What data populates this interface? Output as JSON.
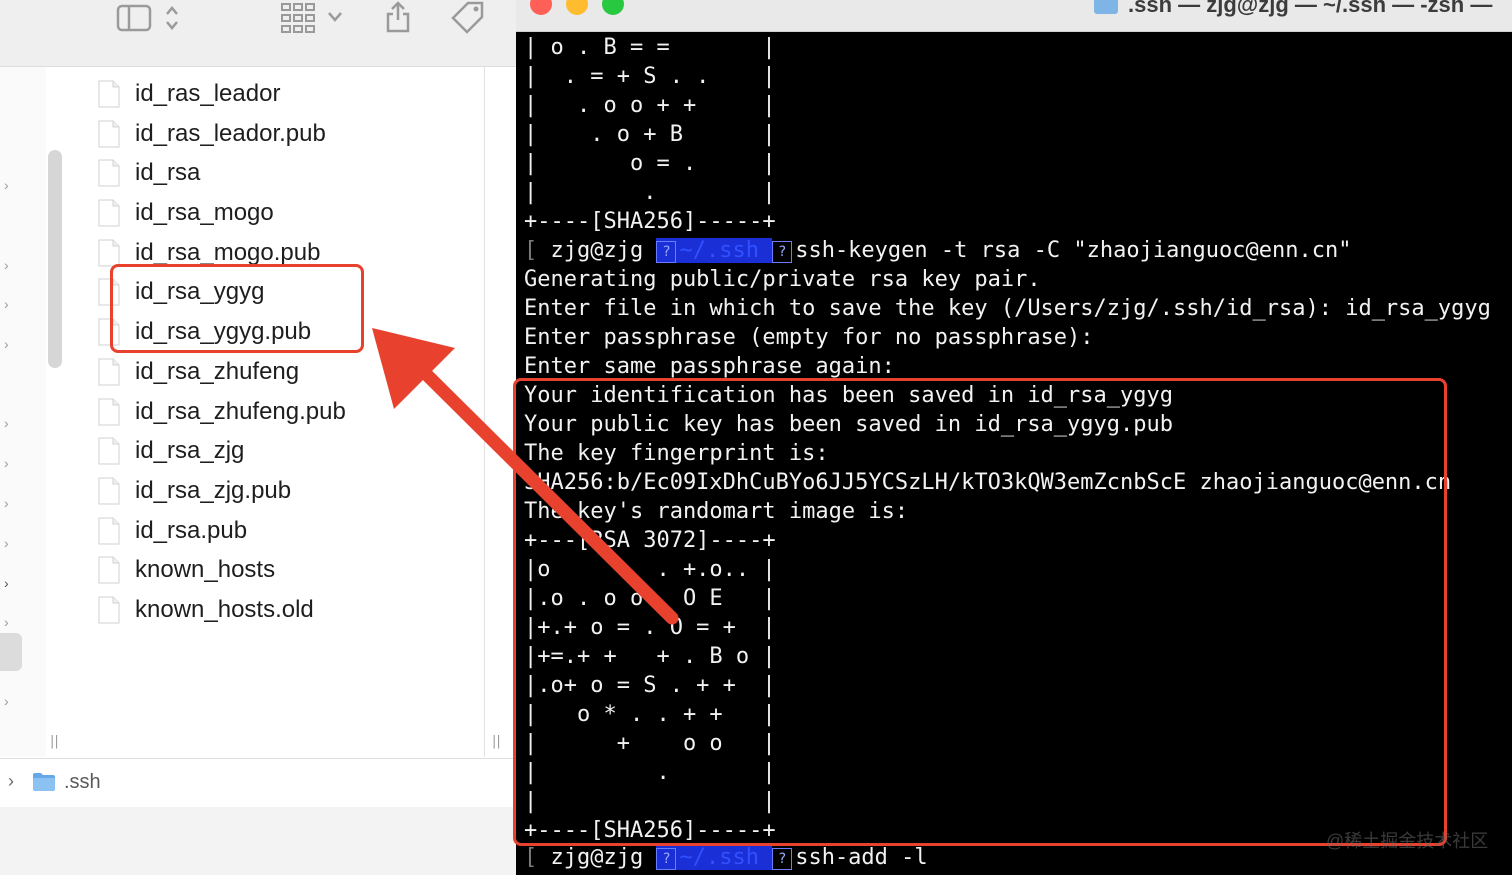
{
  "finder": {
    "toolbar": {
      "icons": [
        "sidebar-toggle-icon",
        "view-grid-icon",
        "share-icon",
        "tag-icon"
      ]
    },
    "files": [
      "id_ras_leador",
      "id_ras_leador.pub",
      "id_rsa",
      "id_rsa_mogo",
      "id_rsa_mogo.pub",
      "id_rsa_ygyg",
      "id_rsa_ygyg.pub",
      "id_rsa_zhufeng",
      "id_rsa_zhufeng.pub",
      "id_rsa_zjg",
      "id_rsa_zjg.pub",
      "id_rsa.pub",
      "known_hosts",
      "known_hosts.old"
    ],
    "path_bar": {
      "folder": ".ssh"
    },
    "highlighted_files": [
      "id_rsa_ygyg",
      "id_rsa_ygyg.pub"
    ]
  },
  "terminal": {
    "title": ".ssh — zjg@zjg — ~/.ssh — -zsh —",
    "prompt": {
      "user": "zjg@zjg",
      "path": "~/.ssh"
    },
    "lines": [
      "| o . B = =       |",
      "|  . = + S . .    |",
      "|   . o o + +     |",
      "|    . o + B      |",
      "|       o = .     |",
      "|        .        |",
      "+----[SHA256]-----+",
      "ssh-keygen -t rsa -C \"zhaojianguoc@enn.cn\"",
      "Generating public/private rsa key pair.",
      "Enter file in which to save the key (/Users/zjg/.ssh/id_rsa): id_rsa_ygyg",
      "Enter passphrase (empty for no passphrase):",
      "Enter same passphrase again:",
      "Your identification has been saved in id_rsa_ygyg",
      "Your public key has been saved in id_rsa_ygyg.pub",
      "The key fingerprint is:",
      "SHA256:b/Ec09IxDhCuBYo6JJ5YCSzLH/kTO3kQW3emZcnbScE zhaojianguoc@enn.cn",
      "The key's randomart image is:",
      "+---[RSA 3072]----+",
      "|o        . +.o.. |",
      "|.o . o o   O E   |",
      "|+.+ o = . O = +  |",
      "|+=.+ +   + . B o |",
      "|.o+ o = S . + +  |",
      "|   o * . . + +   |",
      "|      +    o o   |",
      "|         .       |",
      "|                 |",
      "+----[SHA256]-----+",
      "ssh-add -l"
    ]
  },
  "watermark": "@稀土掘金技术社区",
  "colors": {
    "annotation": "#e8422f",
    "path_highlight": "#1a2fd6",
    "terminal_bg": "#000000"
  }
}
